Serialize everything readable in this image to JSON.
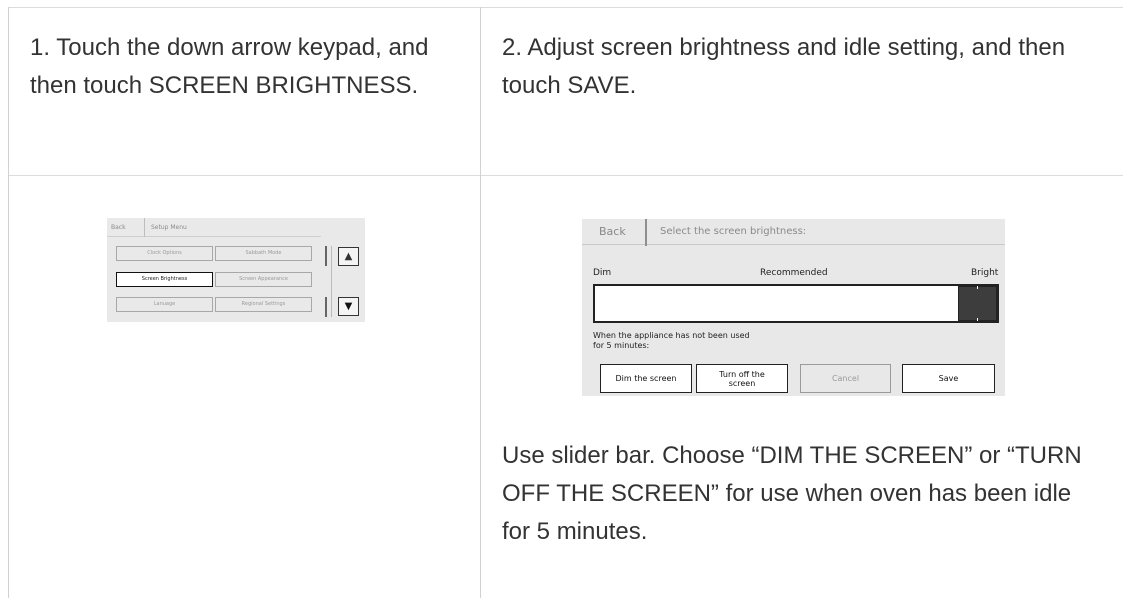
{
  "steps": {
    "step1": "1. Touch the down arrow keypad, and then touch SCREEN BRIGHTNESS.",
    "step2": "2. Adjust screen brightness and idle setting, and then touch SAVE.",
    "step2_note": "Use slider bar. Choose “DIM THE SCREEN” or “TURN OFF THE SCREEN” for use when oven has been idle for 5 minutes."
  },
  "setup_menu": {
    "back_label": "Back",
    "title": "Setup Menu",
    "buttons": [
      "Clock Options",
      "Sabbath Mode",
      "Screen Brightness",
      "Screen Appearance",
      "Lanuage",
      "Regional Settings"
    ],
    "selected_button": "Screen Brightness",
    "up_arrow": "▲",
    "down_arrow": "▼"
  },
  "brightness_screen": {
    "back_label": "Back",
    "title": "Select the screen brightness:",
    "dim_label": "Dim",
    "recommended_label": "Recommended",
    "bright_label": "Bright",
    "slider_level": 1.0,
    "idle_text_line1": "When the appliance has not been used",
    "idle_text_line2": "for 5 minutes:",
    "buttons": {
      "dim": "Dim the screen",
      "turn_off_line1": "Turn off the",
      "turn_off_line2": "screen",
      "cancel": "Cancel",
      "save": "Save"
    }
  }
}
